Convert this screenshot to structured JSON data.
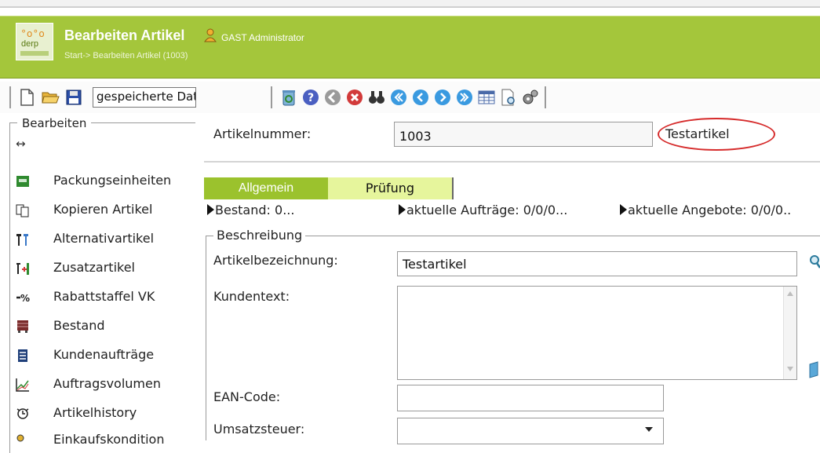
{
  "header": {
    "logo_text": "derp",
    "title": "Bearbeiten Artikel",
    "user": "GAST Administrator",
    "breadcrumb": "Start-> Bearbeiten Artikel (1003)"
  },
  "toolbar": {
    "data_select_value": "gespeicherte Daten",
    "buttons": [
      "new-document-icon",
      "open-folder-icon",
      "save-disk-icon",
      "recycle-icon",
      "help-icon",
      "back-arrow-icon",
      "delete-icon",
      "binoculars-icon",
      "first-icon",
      "previous-icon",
      "next-icon",
      "last-icon",
      "table-icon",
      "print-preview-icon",
      "settings-icon"
    ]
  },
  "sidebar": {
    "legend": "Bearbeiten",
    "resize_glyph": "↔",
    "items": [
      {
        "label": "Packungseinheiten",
        "icon": "packaging-units-icon"
      },
      {
        "label": "Kopieren Artikel",
        "icon": "copy-article-icon"
      },
      {
        "label": "Alternativartikel",
        "icon": "alternative-article-icon"
      },
      {
        "label": "Zusatzartikel",
        "icon": "additional-article-icon"
      },
      {
        "label": "Rabattstaffel VK",
        "icon": "discount-scale-icon"
      },
      {
        "label": "Bestand",
        "icon": "stock-icon"
      },
      {
        "label": "Kundenaufträge",
        "icon": "customer-orders-icon"
      },
      {
        "label": "Auftragsvolumen",
        "icon": "order-volume-chart-icon"
      },
      {
        "label": "Artikelhistory",
        "icon": "article-history-icon"
      },
      {
        "label": "Einkaufskondition",
        "icon": "purchase-conditions-icon"
      }
    ]
  },
  "main": {
    "article_number_label": "Artikelnummer:",
    "article_number_value": "1003",
    "article_name_display": "Testartikel",
    "tabs": [
      "Allgemein",
      "Prüfung"
    ],
    "status": {
      "stock": "Bestand: 0...",
      "orders": "aktuelle Aufträge: 0/0/0...",
      "offers": "aktuelle Angebote: 0/0/0.."
    },
    "description_legend": "Beschreibung",
    "fields": {
      "designation_label": "Artikelbezeichnung:",
      "designation_value": "Testartikel",
      "customer_text_label": "Kundentext:",
      "customer_text_value": "",
      "ean_label": "EAN-Code:",
      "ean_value": "",
      "vat_label": "Umsatzsteuer:",
      "vat_value": ""
    }
  },
  "colors": {
    "header_green": "#a4c63b",
    "tab_active": "#9bc22d",
    "tab_inactive": "#e6f59c",
    "highlight_ring": "#d62c2c"
  }
}
